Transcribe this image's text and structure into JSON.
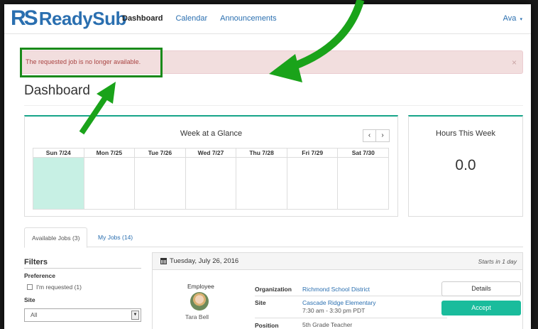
{
  "brand": {
    "prefix": "RS",
    "name": "ReadySub"
  },
  "nav": {
    "links": [
      "Dashboard",
      "Calendar",
      "Announcements"
    ],
    "user": "Ava",
    "user_caret": "▾"
  },
  "alert": {
    "message": "The requested job is no longer available.",
    "close": "×"
  },
  "page_title": "Dashboard",
  "week": {
    "title": "Week at a Glance",
    "prev": "‹",
    "next": "›",
    "days": [
      "Sun 7/24",
      "Mon 7/25",
      "Tue 7/26",
      "Wed 7/27",
      "Thu 7/28",
      "Fri 7/29",
      "Sat 7/30"
    ]
  },
  "hours": {
    "title": "Hours This Week",
    "value": "0.0"
  },
  "tabs": [
    "Available Jobs (3)",
    "My Jobs (14)"
  ],
  "filters": {
    "title": "Filters",
    "preference_label": "Preference",
    "requested": "I'm requested (1)",
    "site_label": "Site",
    "site_value": "All"
  },
  "job": {
    "date": "Tuesday, July 26, 2016",
    "starts": "Starts in 1 day",
    "employee_label": "Employee",
    "employee_name": "Tara Bell",
    "organization_label": "Organization",
    "organization": "Richmond School District",
    "site_label": "Site",
    "site": "Cascade Ridge Elementary",
    "time": "7:30 am - 3:30 pm PDT",
    "position_label": "Position",
    "position": "5th Grade Teacher",
    "details_label": "Details",
    "accept_label": "Accept"
  },
  "colors": {
    "brand_blue": "#2a6fb0",
    "accent_teal": "#17a589",
    "accept_green": "#1abc9c",
    "alert_bg": "#f2dede",
    "alert_text": "#a94442",
    "annotation_green": "#1a8a1a"
  }
}
